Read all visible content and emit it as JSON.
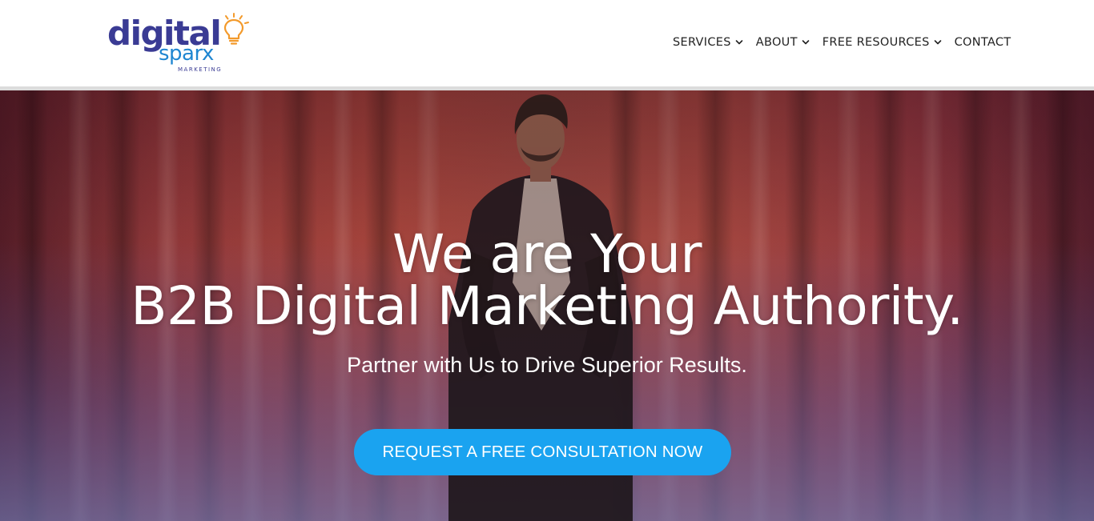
{
  "logo": {
    "line1": "digital",
    "line2": "sparx",
    "line3": "MARKETING",
    "brand_dark": "#3a3b94",
    "brand_blue": "#1f86d1",
    "brand_orange": "#f39a2b",
    "icon": "lightbulb-icon"
  },
  "nav": {
    "items": [
      {
        "label": "SERVICES",
        "has_dropdown": true
      },
      {
        "label": "ABOUT",
        "has_dropdown": true
      },
      {
        "label": "FREE RESOURCES",
        "has_dropdown": true
      },
      {
        "label": "CONTACT",
        "has_dropdown": false
      }
    ],
    "text_color": "#222222",
    "dropdown_icon": "chevron-down-icon"
  },
  "hero": {
    "title_line1": "We are Your",
    "title_line2": "B2B Digital Marketing Authority.",
    "subtitle": "Partner with Us to Drive Superior Results.",
    "cta_label": "REQUEST A FREE CONSULTATION NOW",
    "cta_color": "#1aa3f0",
    "background": "video-still of a speaker on stage with red curtains"
  }
}
